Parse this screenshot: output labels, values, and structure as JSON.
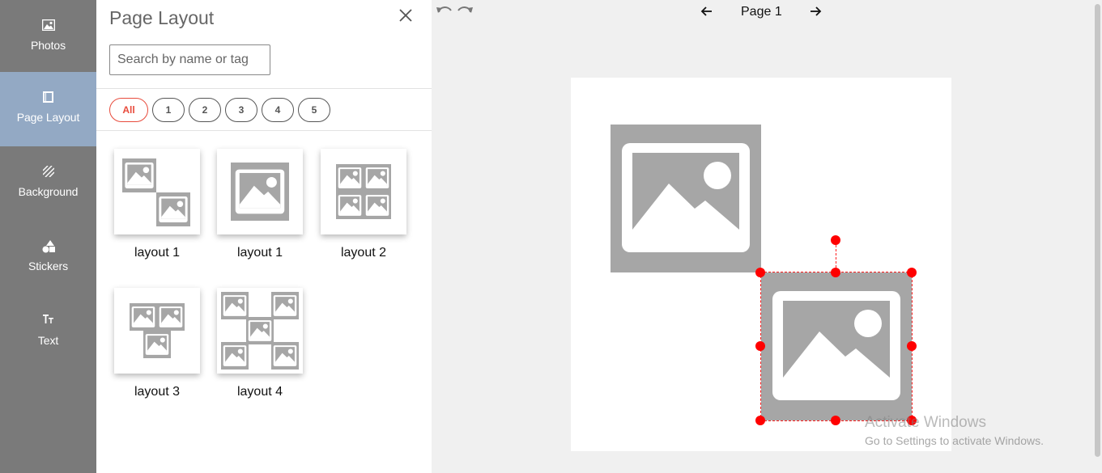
{
  "nav": {
    "items": [
      {
        "label": "Photos",
        "icon": "image-icon"
      },
      {
        "label": "Page Layout",
        "icon": "layout-icon",
        "active": true
      },
      {
        "label": "Background",
        "icon": "pattern-icon"
      },
      {
        "label": "Stickers",
        "icon": "shapes-icon"
      },
      {
        "label": "Text",
        "icon": "text-icon"
      }
    ]
  },
  "panel": {
    "title": "Page Layout",
    "search_placeholder": "Search by name or tag",
    "filters": [
      "All",
      "1",
      "2",
      "3",
      "4",
      "5"
    ],
    "layouts": [
      {
        "label": "layout 1"
      },
      {
        "label": "layout 1"
      },
      {
        "label": "layout 2"
      },
      {
        "label": "layout 3"
      },
      {
        "label": "layout 4"
      }
    ]
  },
  "canvas": {
    "page_label": "Page 1"
  },
  "watermark": {
    "line1": "Activate Windows",
    "line2": "Go to Settings to activate Windows."
  },
  "colors": {
    "nav_bg": "#7a7a7a",
    "nav_active": "#93a9c4",
    "accent": "#e84b3c",
    "selection": "#ff0000",
    "placeholder_gray": "#a6a6a6"
  }
}
